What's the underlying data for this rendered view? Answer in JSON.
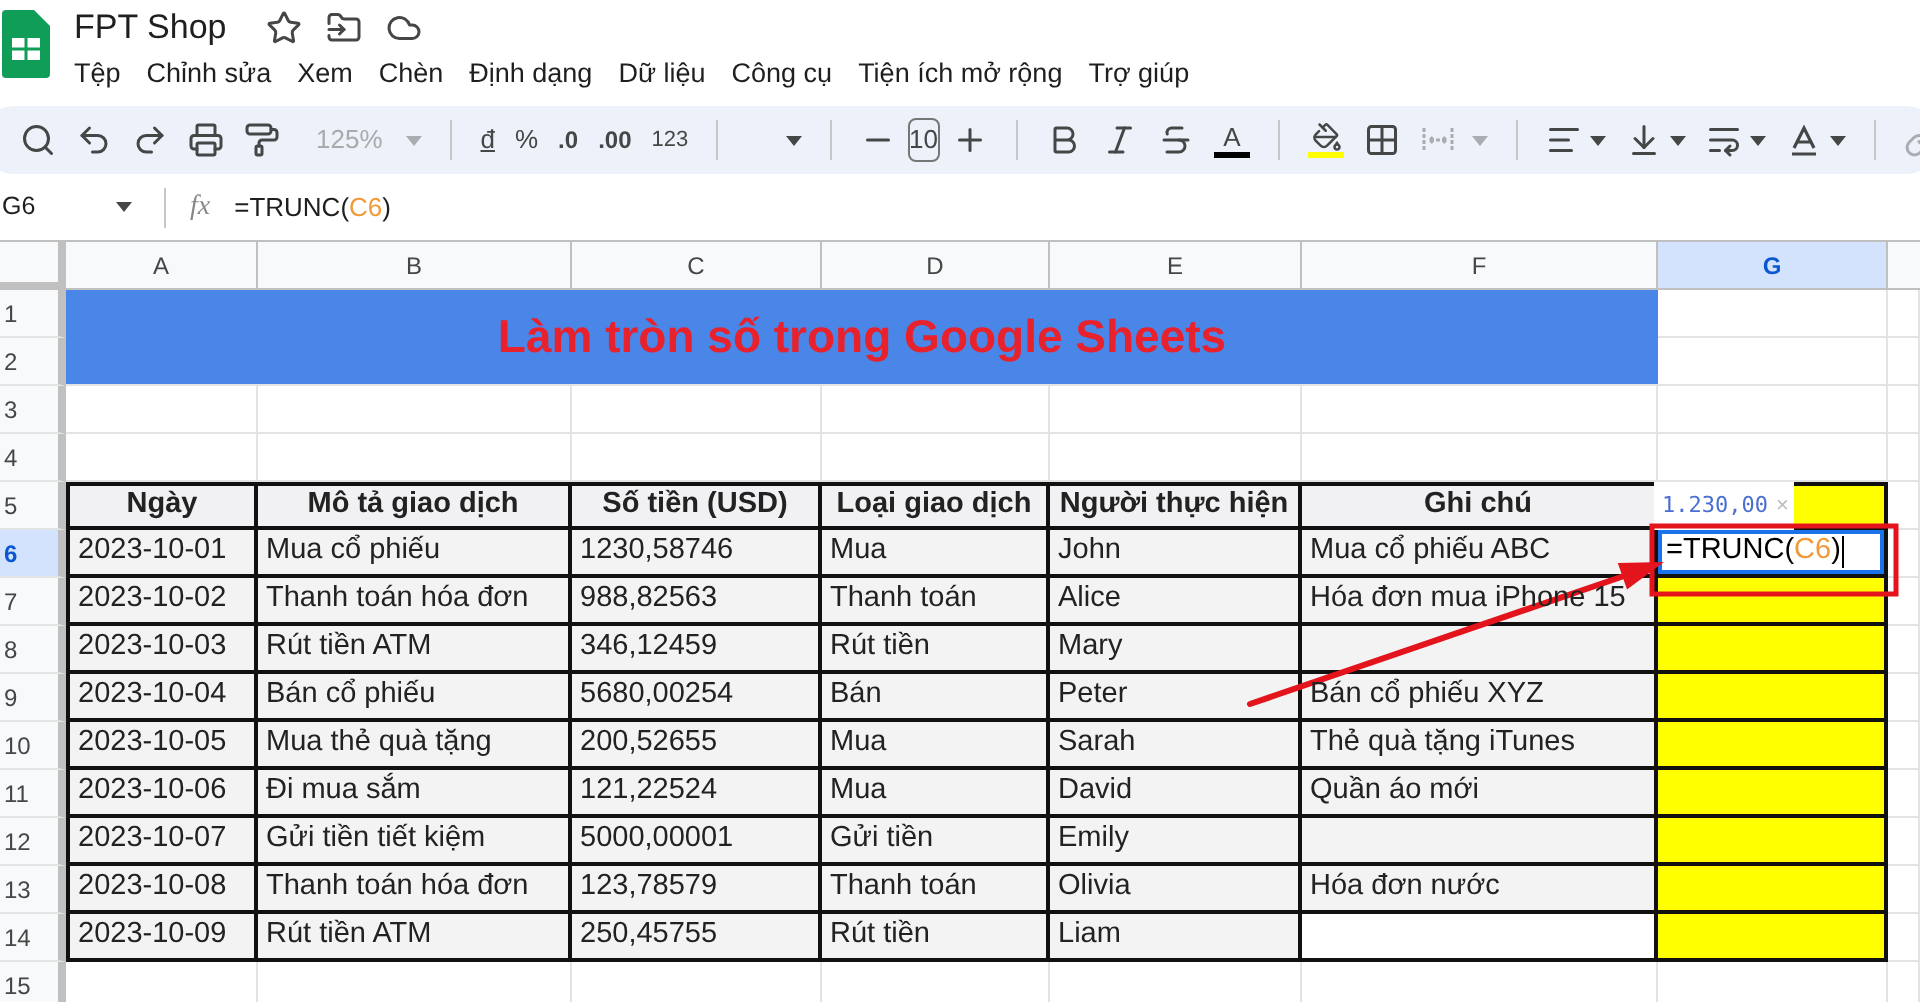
{
  "app": {
    "title": "FPT Shop",
    "menu": [
      "Tệp",
      "Chỉnh sửa",
      "Xem",
      "Chèn",
      "Định dạng",
      "Dữ liệu",
      "Công cụ",
      "Tiện ích mở rộng",
      "Trợ giúp"
    ]
  },
  "toolbar": {
    "zoom": "125%",
    "currency": "đ",
    "percent": "%",
    "decrease_decimals": ".0",
    "increase_decimals": ".00",
    "number_format": "123",
    "font_size": "10",
    "text_color_label": "A"
  },
  "formula_bar": {
    "cell_ref": "G6",
    "fx": "fx",
    "formula_parts": [
      {
        "text": "=TRUNC(",
        "kind": "plain"
      },
      {
        "text": "C6",
        "kind": "ref"
      },
      {
        "text": ")",
        "kind": "plain"
      }
    ]
  },
  "sheet": {
    "columns": [
      {
        "label": "A",
        "selected": false
      },
      {
        "label": "B",
        "selected": false
      },
      {
        "label": "C",
        "selected": false
      },
      {
        "label": "D",
        "selected": false
      },
      {
        "label": "E",
        "selected": false
      },
      {
        "label": "F",
        "selected": false
      },
      {
        "label": "G",
        "selected": true
      }
    ],
    "row_numbers": [
      {
        "label": "1",
        "selected": false
      },
      {
        "label": "2",
        "selected": false
      },
      {
        "label": "3",
        "selected": false
      },
      {
        "label": "4",
        "selected": false
      },
      {
        "label": "5",
        "selected": false
      },
      {
        "label": "6",
        "selected": true
      },
      {
        "label": "7",
        "selected": false
      },
      {
        "label": "8",
        "selected": false
      },
      {
        "label": "9",
        "selected": false
      },
      {
        "label": "10",
        "selected": false
      },
      {
        "label": "11",
        "selected": false
      },
      {
        "label": "12",
        "selected": false
      },
      {
        "label": "13",
        "selected": false
      },
      {
        "label": "14",
        "selected": false
      },
      {
        "label": "15",
        "selected": false
      }
    ],
    "title": "Làm tròn số trong Google Sheets",
    "headers": [
      "Ngày",
      "Mô tả giao dịch",
      "Số tiền (USD)",
      "Loại giao dịch",
      "Người thực hiện",
      "Ghi chú"
    ],
    "rows": [
      {
        "date": "2023-10-01",
        "description": "Mua cổ phiếu",
        "amount": "1230,58746",
        "type": "Mua",
        "person": "John",
        "note": "Mua cổ phiếu ABC"
      },
      {
        "date": "2023-10-02",
        "description": "Thanh toán hóa đơn",
        "amount": "988,82563",
        "type": "Thanh toán",
        "person": "Alice",
        "note": "Hóa đơn mua iPhone 15"
      },
      {
        "date": "2023-10-03",
        "description": "Rút tiền ATM",
        "amount": "346,12459",
        "type": "Rút tiền",
        "person": "Mary"
      },
      {
        "date": "2023-10-04",
        "description": "Bán cổ phiếu",
        "amount": "5680,00254",
        "type": "Bán",
        "person": "Peter",
        "note": "Bán cổ phiếu XYZ"
      },
      {
        "date": "2023-10-05",
        "description": "Mua thẻ quà tặng",
        "amount": "200,52655",
        "type": "Mua",
        "person": "Sarah",
        "note": "Thẻ quà tặng iTunes"
      },
      {
        "date": "2023-10-06",
        "description": "Đi mua sắm",
        "amount": "121,22524",
        "type": "Mua",
        "person": "David",
        "note": "Quần áo mới"
      },
      {
        "date": "2023-10-07",
        "description": "Gửi tiền tiết kiệm",
        "amount": "5000,00001",
        "type": "Gửi tiền",
        "person": "Emily"
      },
      {
        "date": "2023-10-08",
        "description": "Thanh toán hóa đơn",
        "amount": "123,78579",
        "type": "Thanh toán",
        "person": "Olivia",
        "note": "Hóa đơn nước"
      },
      {
        "date": "2023-10-09",
        "description": "Rút tiền ATM",
        "amount": "250,45755",
        "type": "Rút tiền",
        "person": "Liam"
      }
    ],
    "active_cell": {
      "formula_parts": [
        {
          "text": "=TRUNC(",
          "kind": "plain"
        },
        {
          "text": "C6",
          "kind": "ref"
        },
        {
          "text": ")",
          "kind": "plain"
        }
      ]
    },
    "preview_tooltip": {
      "value": "1.230,00",
      "close": "×"
    }
  }
}
